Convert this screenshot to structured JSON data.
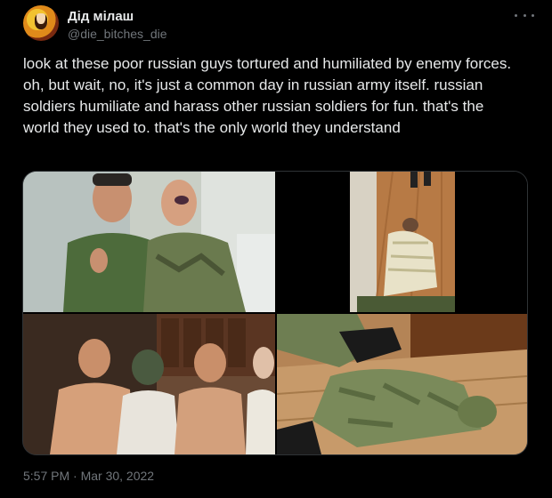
{
  "author": {
    "name": "Дід мілаш",
    "handle": "@die_bitches_die"
  },
  "tweet": {
    "text": "look at these poor russian guys tortured and humiliated by enemy forces.\noh, but wait, no, it's just a common day in russian army itself. russian soldiers humiliate and harass other russian soldiers for fun. that's the world they used to. that's the only world they understand"
  },
  "media": {
    "photos": [
      {
        "description_icon": "photo-icon"
      },
      {
        "description_icon": "photo-icon"
      },
      {
        "description_icon": "photo-icon"
      },
      {
        "description_icon": "photo-icon"
      }
    ]
  },
  "timestamp": "5:57 PM · Mar 30, 2022",
  "colors": {
    "background": "#000000",
    "text": "#e7e9ea",
    "muted": "#71767b",
    "border": "#2f3336"
  }
}
